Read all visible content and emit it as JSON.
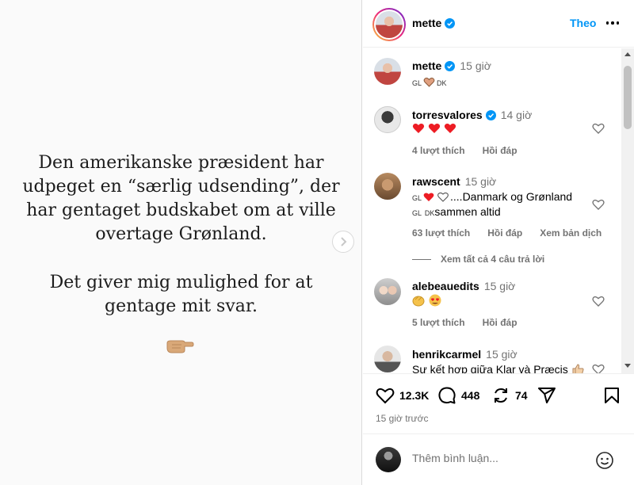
{
  "post": {
    "paragraph1": "Den amerikanske præsident har\nudpeget en “særlig udsending”, der\nhar gentaget budskabet om at ville\novertage Grønland.",
    "paragraph2": "Det giver mig mulighed for at\ngentage mit svar.",
    "pointer_icon": "pointing-hand-icon"
  },
  "header": {
    "username": "mette",
    "follow_label": "Theo",
    "more_icon": "more-icon"
  },
  "caption": {
    "username": "mette",
    "time": "15 giờ",
    "text_gl": "GL",
    "text_dk": "DK"
  },
  "comments": [
    {
      "username": "torresvalores",
      "verified": true,
      "time": "14 giờ",
      "text": "",
      "likes": "4 lượt thích",
      "reply": "Hồi đáp"
    },
    {
      "username": "rawscent",
      "verified": false,
      "time": "15 giờ",
      "line1_gl": "GL",
      "line1_text": "....Danmark og Grønland",
      "line2_gl": "GL",
      "line2_dk": "DK",
      "line2_text": "sammen altid",
      "likes": "63 lượt thích",
      "reply": "Hồi đáp",
      "translate": "Xem bản dịch",
      "view_replies": "Xem tất cả 4 câu trả lời"
    },
    {
      "username": "alebeauedits",
      "verified": false,
      "time": "15 giờ",
      "likes": "5 lượt thích",
      "reply": "Hồi đáp"
    },
    {
      "username": "henrikcarmel",
      "verified": false,
      "time": "15 giờ",
      "text": "Sự kết hợp giữa Klar và Præcis"
    }
  ],
  "actions": {
    "like_count": "12.3K",
    "comment_count": "448",
    "repost_count": "74",
    "post_time": "15 giờ trước"
  },
  "add_comment": {
    "placeholder": "Thêm bình luận..."
  },
  "colors": {
    "accent": "#0095f6",
    "heart_red": "#ed1c24",
    "muted": "#737373"
  }
}
